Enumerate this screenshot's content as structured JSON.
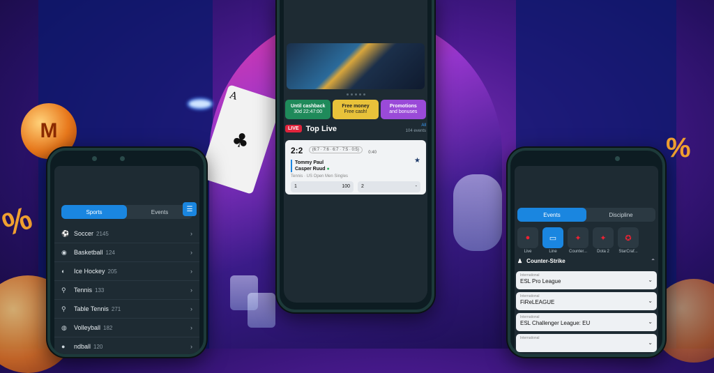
{
  "left_phone": {
    "tabs": {
      "sports": "Sports",
      "events": "Events"
    },
    "sports": [
      {
        "icon": "soccer-icon",
        "glyph": "⚽",
        "name": "Soccer",
        "count": "2145"
      },
      {
        "icon": "basketball-icon",
        "glyph": "◉",
        "name": "Basketball",
        "count": "124"
      },
      {
        "icon": "ice-hockey-icon",
        "glyph": "◐",
        "name": "Ice Hockey",
        "count": "205"
      },
      {
        "icon": "tennis-icon",
        "glyph": "⚲",
        "name": "Tennis",
        "count": "133"
      },
      {
        "icon": "table-tennis-icon",
        "glyph": "⚲",
        "name": "Table Tennis",
        "count": "271"
      },
      {
        "icon": "volleyball-icon",
        "glyph": "◍",
        "name": "Volleyball",
        "count": "182"
      },
      {
        "icon": "handball-icon",
        "glyph": "●",
        "name": "ndball",
        "count": "120"
      }
    ]
  },
  "center_phone": {
    "promos": [
      {
        "title": "Until cashback",
        "subtitle": "30d 22:47:00",
        "color": "#1f8a5a"
      },
      {
        "title": "Free money",
        "subtitle": "Free cash!",
        "color": "#e8c23a"
      },
      {
        "title": "Promotions",
        "subtitle": "and bonuses",
        "color": "#9a4ad8"
      }
    ],
    "section": {
      "badge": "LIVE",
      "title": "Top Live",
      "all": "All",
      "events": "104 events"
    },
    "match": {
      "score": "2:2",
      "sets": "(6:7 · 7:6 · 6:7 · 7:5 · 0:5)",
      "time": "0:40",
      "player1": "Tommy Paul",
      "player2": "Casper Ruud",
      "league": "Tennis · US Open Men Singles",
      "odds": [
        {
          "label": "1",
          "value": "100"
        },
        {
          "label": "2",
          "value": "-"
        }
      ]
    }
  },
  "right_phone": {
    "tabs": {
      "events": "Events",
      "discipline": "Discipline"
    },
    "categories": [
      {
        "icon": "live-icon",
        "glyph": "●",
        "label": "Live"
      },
      {
        "icon": "line-icon",
        "glyph": "▭",
        "label": "Line"
      },
      {
        "icon": "counter-strike-icon",
        "glyph": "✦",
        "label": "Counter..."
      },
      {
        "icon": "dota-icon",
        "glyph": "✦",
        "label": "Dota 2"
      },
      {
        "icon": "starcraft-icon",
        "glyph": "✪",
        "label": "StarCraf..."
      }
    ],
    "discipline": "Counter-Strike",
    "championships": [
      {
        "kind": "International",
        "name": "ESL Pro League"
      },
      {
        "kind": "International",
        "name": "FiReLEAGUE"
      },
      {
        "kind": "International",
        "name": "ESL Challenger League: EU"
      },
      {
        "kind": "International",
        "name": ""
      }
    ]
  },
  "decor": {
    "coin_symbol": "M",
    "percent": "%"
  }
}
